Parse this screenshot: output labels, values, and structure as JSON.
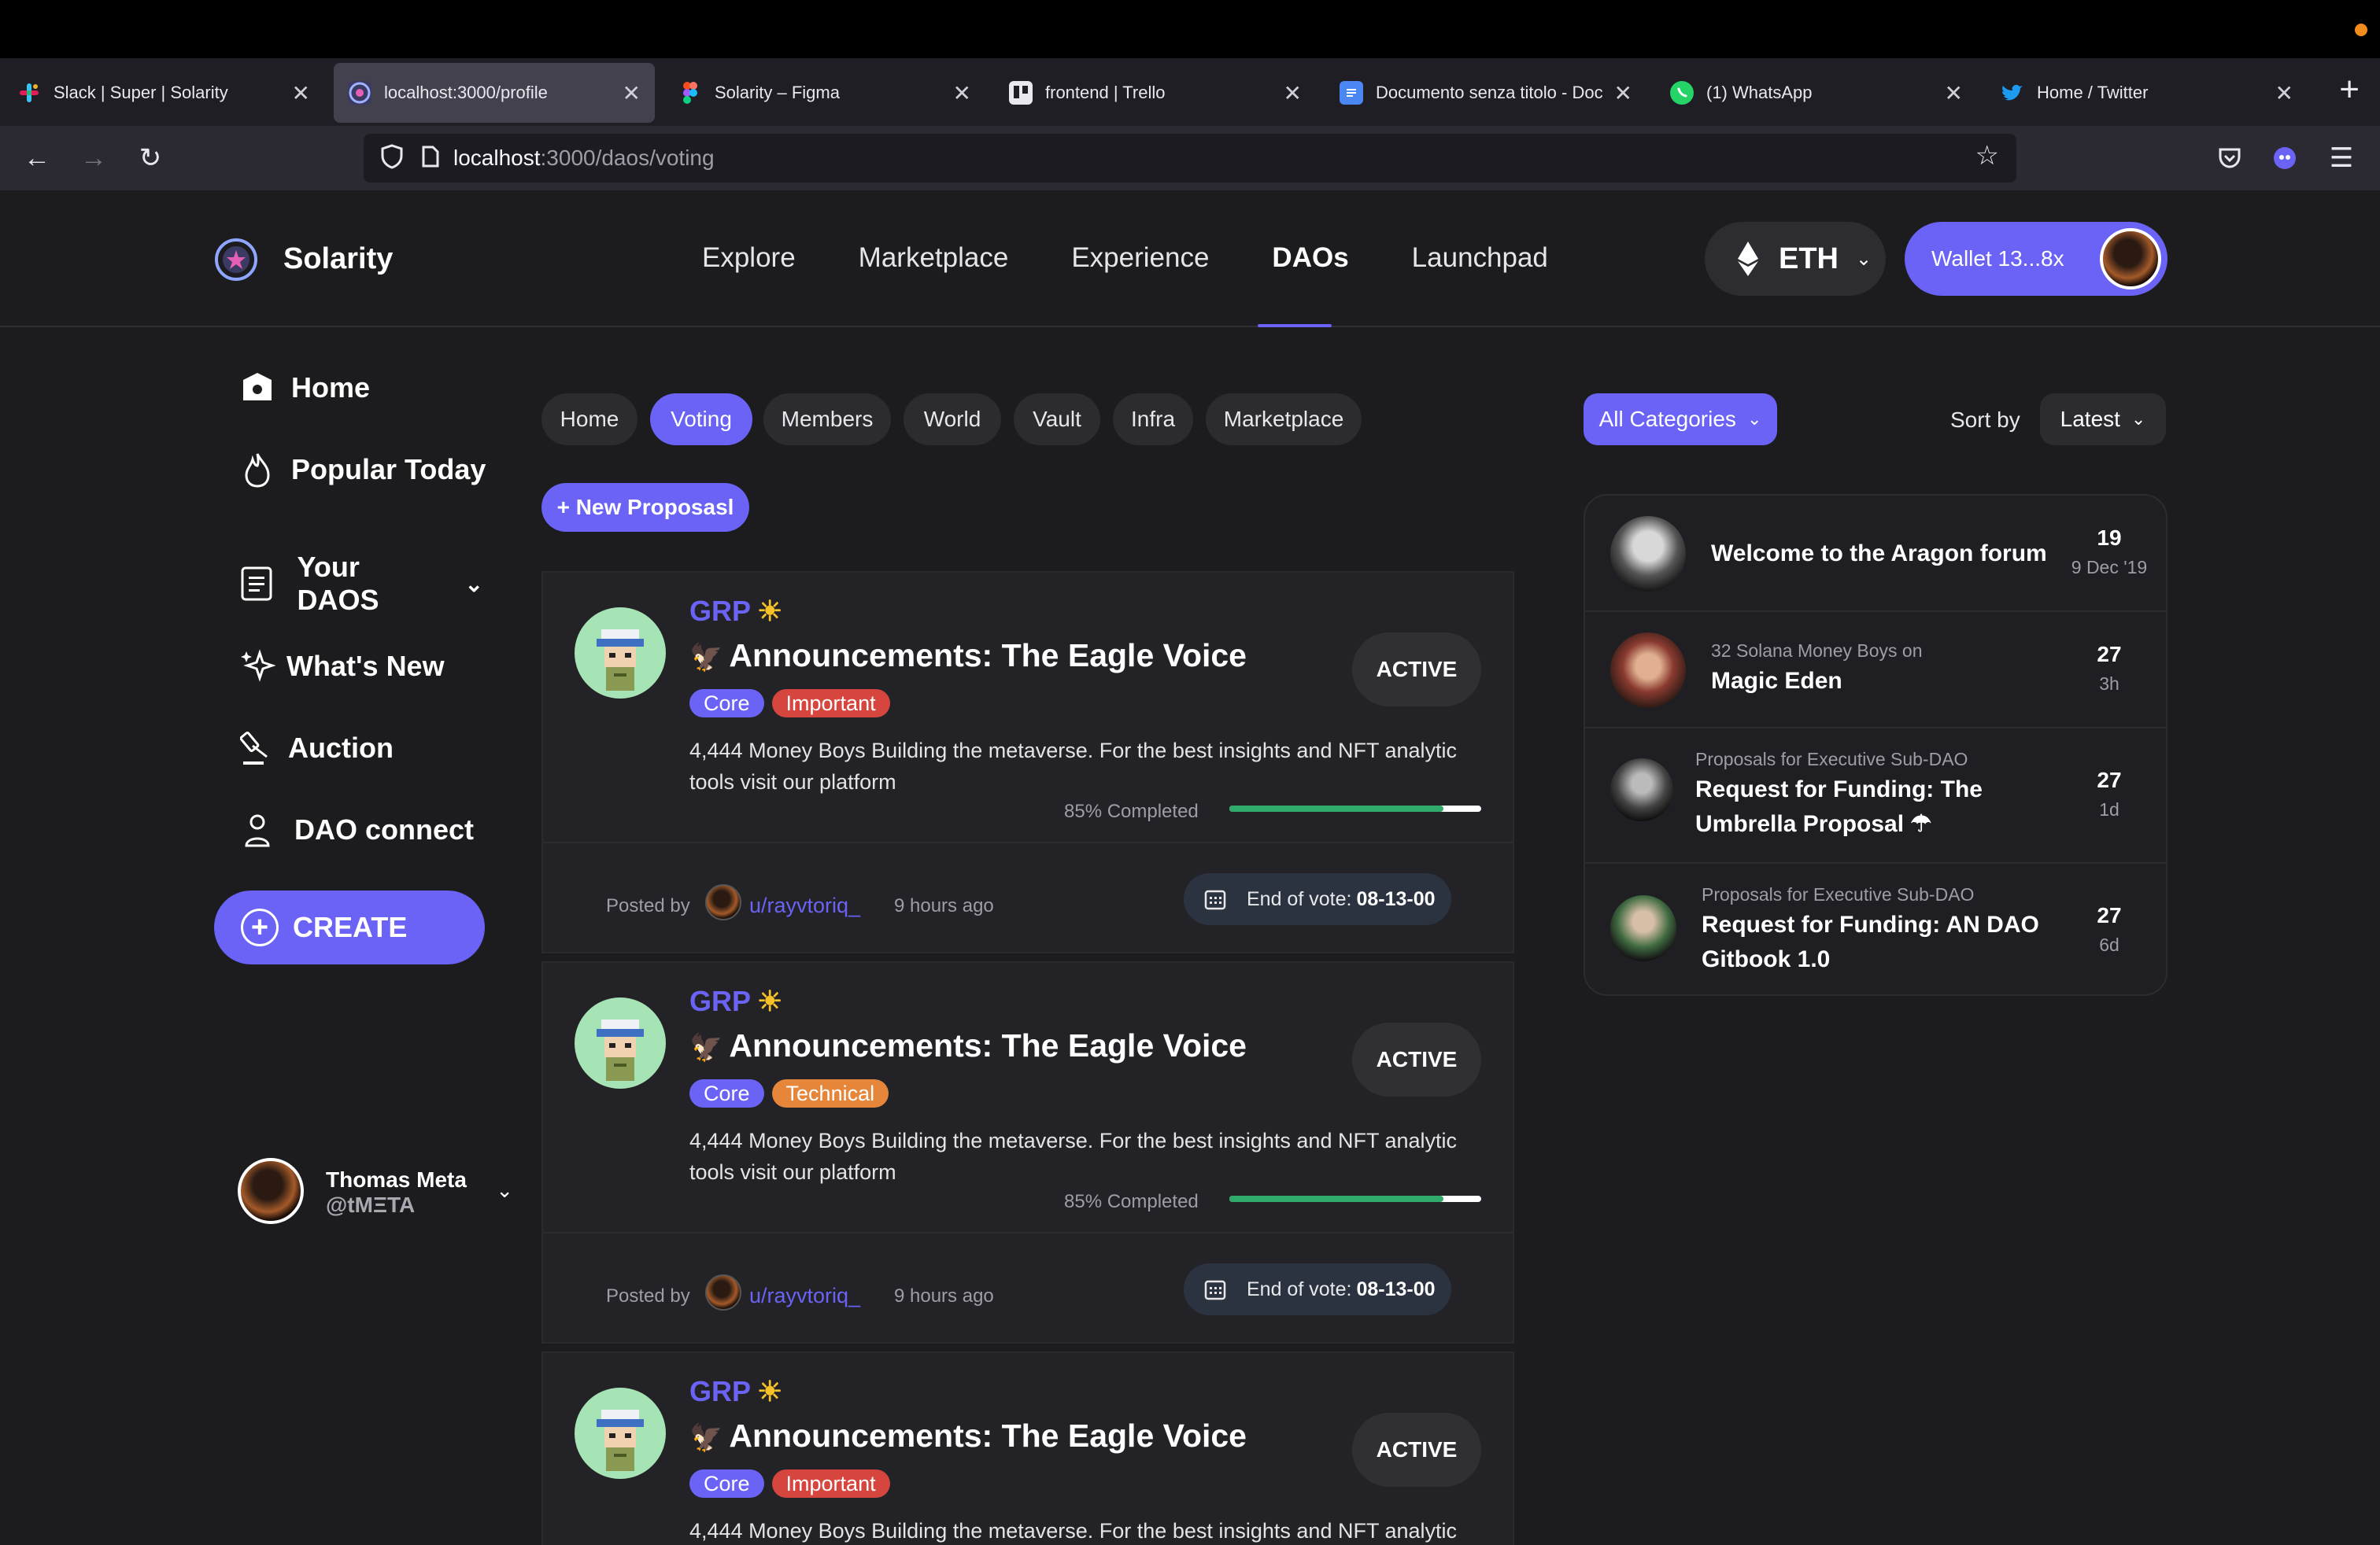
{
  "browser": {
    "tabs": [
      {
        "title": "Slack | Super | Solarity",
        "icon": "slack-icon",
        "active": false
      },
      {
        "title": "localhost:3000/profile",
        "icon": "solarity-icon",
        "active": true
      },
      {
        "title": "Solarity – Figma",
        "icon": "figma-icon",
        "active": false
      },
      {
        "title": "frontend | Trello",
        "icon": "trello-icon",
        "active": false
      },
      {
        "title": "Documento senza titolo - Doc",
        "icon": "docs-icon",
        "active": false
      },
      {
        "title": "(1) WhatsApp",
        "icon": "whatsapp-icon",
        "active": false
      },
      {
        "title": "Home / Twitter",
        "icon": "twitter-icon",
        "active": false
      }
    ],
    "url_host": "localhost",
    "url_path": ":3000/daos/voting"
  },
  "header": {
    "brand": "Solarity",
    "nav": [
      "Explore",
      "Marketplace",
      "Experience",
      "DAOs",
      "Launchpad"
    ],
    "active_nav": "DAOs",
    "network": "ETH",
    "wallet": "Wallet 13...8x"
  },
  "sidebar": {
    "items": [
      {
        "label": "Home",
        "icon": "home-icon"
      },
      {
        "label": "Popular Today",
        "icon": "flame-icon"
      },
      {
        "label": "Your DAOS",
        "icon": "document-icon"
      },
      {
        "label": "What's New",
        "icon": "sparkle-icon"
      },
      {
        "label": "Auction",
        "icon": "gavel-icon"
      },
      {
        "label": "DAO connect",
        "icon": "user-icon"
      }
    ],
    "create_label": "CREATE",
    "user": {
      "name": "Thomas Meta",
      "handle": "@tMΞTA"
    }
  },
  "filters": {
    "chips": [
      "Home",
      "Voting",
      "Members",
      "World",
      "Vault",
      "Infra",
      "Marketplace"
    ],
    "active_chip": "Voting",
    "category": "All Categories",
    "sort_label": "Sort by",
    "sort_value": "Latest",
    "new_proposal": "+ New Proposasl"
  },
  "proposals": [
    {
      "group": "GRP",
      "title": "Announcements: The Eagle Voice",
      "tags": [
        {
          "label": "Core",
          "kind": "core"
        },
        {
          "label": "Important",
          "kind": "important"
        }
      ],
      "description": "4,444 Money Boys Building the metaverse. For the best insights and NFT analytic tools visit our platform",
      "status": "ACTIVE",
      "progress_label": "85% Completed",
      "progress": 0.85,
      "posted_by_label": "Posted by",
      "author": "u/rayvtoriq_",
      "posted_ago": "9 hours ago",
      "vote_end_label": "End of vote:",
      "vote_end_date": "08-13-00"
    },
    {
      "group": "GRP",
      "title": "Announcements: The Eagle Voice",
      "tags": [
        {
          "label": "Core",
          "kind": "core"
        },
        {
          "label": "Technical",
          "kind": "technical"
        }
      ],
      "description": "4,444 Money Boys Building the metaverse. For the best insights and NFT analytic tools visit our platform",
      "status": "ACTIVE",
      "progress_label": "85% Completed",
      "progress": 0.85,
      "posted_by_label": "Posted by",
      "author": "u/rayvtoriq_",
      "posted_ago": "9 hours ago",
      "vote_end_label": "End of vote:",
      "vote_end_date": "08-13-00"
    },
    {
      "group": "GRP",
      "title": "Announcements: The Eagle Voice",
      "tags": [
        {
          "label": "Core",
          "kind": "core"
        },
        {
          "label": "Important",
          "kind": "important"
        }
      ],
      "description": "4,444 Money Boys Building the metaverse. For the best insights and NFT analytic"
    }
  ],
  "forum": [
    {
      "subtitle": "",
      "title": "Welcome to the Aragon forum",
      "count": "19",
      "age": "9 Dec '19"
    },
    {
      "subtitle": "32 Solana Money Boys on",
      "title": "Magic Eden",
      "count": "27",
      "age": "3h"
    },
    {
      "subtitle": "Proposals for Executive Sub-DAO",
      "title": "Request for Funding: The Umbrella Proposal ☂",
      "count": "27",
      "age": "1d"
    },
    {
      "subtitle": "Proposals for Executive Sub-DAO",
      "title": "Request for Funding: AN DAO Gitbook 1.0",
      "count": "27",
      "age": "6d"
    }
  ],
  "colors": {
    "accent": "#6a63f5",
    "important": "#d7463e",
    "technical": "#e5863a",
    "progress": "#2faa6a"
  }
}
